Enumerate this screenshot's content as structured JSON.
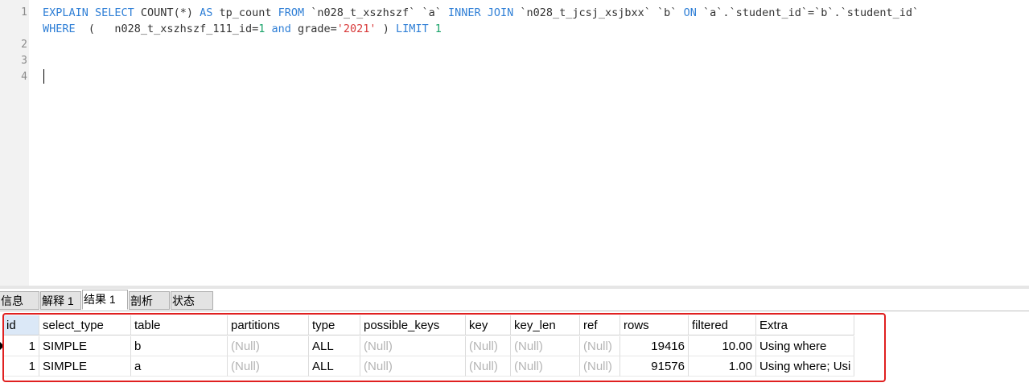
{
  "editor": {
    "line_numbers": [
      "1",
      "2",
      "3",
      "4"
    ],
    "line1": {
      "t1": "EXPLAIN SELECT",
      "t2": " COUNT(*) ",
      "t3": "AS",
      "t4": " tp_count ",
      "t5": "FROM",
      "t6": " `n028_t_xszhszf` `a` ",
      "t7": "INNER JOIN",
      "t8": " `n028_t_jcsj_xsjbxx` `b` ",
      "t9": "ON",
      "t10": " `a`.`student_id`=`b`.`student_id`"
    },
    "line1b": {
      "t1": "WHERE",
      "t2": "  (   n028_t_xszhszf_111_id=",
      "t3": "1",
      "t4": " ",
      "t5": "and",
      "t6": " grade=",
      "t7": "'2021'",
      "t8": " ) ",
      "t9": "LIMIT",
      "t10": " ",
      "t11": "1"
    }
  },
  "tabs": [
    "信息",
    "解释 1",
    "结果 1",
    "剖析",
    "状态"
  ],
  "active_tab": "结果 1",
  "table": {
    "columns": [
      "id",
      "select_type",
      "table",
      "partitions",
      "type",
      "possible_keys",
      "key",
      "key_len",
      "ref",
      "rows",
      "filtered",
      "Extra"
    ],
    "rows": [
      [
        "1",
        "SIMPLE",
        "b",
        "(Null)",
        "ALL",
        "(Null)",
        "(Null)",
        "(Null)",
        "(Null)",
        "19416",
        "10.00",
        "Using where"
      ],
      [
        "1",
        "SIMPLE",
        "a",
        "(Null)",
        "ALL",
        "(Null)",
        "(Null)",
        "(Null)",
        "(Null)",
        "91576",
        "1.00",
        "Using where; Usi"
      ]
    ]
  },
  "colors": {
    "keyword": "#2f7fd6",
    "number": "#1aa36a",
    "string": "#d83a3a",
    "highlight_border": "#e02020"
  }
}
